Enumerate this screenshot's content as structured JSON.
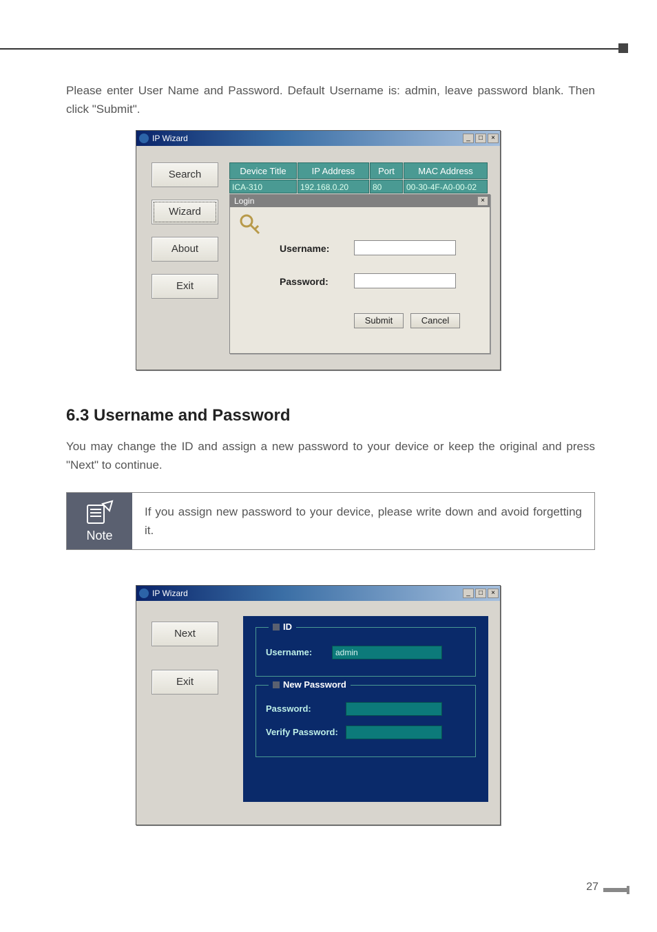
{
  "para1": "Please enter User Name and Password. Default Username is: admin, leave password blank. Then click \"Submit\".",
  "heading": "6.3 Username and Password",
  "para2": "You may change the ID and assign a new password to your device or keep the original and press \"Next\" to continue.",
  "note": {
    "label": "Note",
    "text": "If you assign new password to your device, please write down and avoid forgetting it."
  },
  "win1": {
    "title": "IP Wizard",
    "buttons": {
      "search": "Search",
      "wizard": "Wizard",
      "about": "About",
      "exit": "Exit"
    },
    "headers": {
      "device": "Device Title",
      "ip": "IP Address",
      "port": "Port",
      "mac": "MAC Address"
    },
    "row": {
      "device": "ICA-310",
      "ip": "192.168.0.20",
      "port": "80",
      "mac": "00-30-4F-A0-00-02"
    },
    "login": {
      "title": "Login",
      "username_label": "Username:",
      "password_label": "Password:",
      "submit": "Submit",
      "cancel": "Cancel"
    }
  },
  "win2": {
    "title": "IP Wizard",
    "buttons": {
      "next": "Next",
      "exit": "Exit"
    },
    "id_legend": "ID",
    "username_label": "Username:",
    "username_value": "admin",
    "np_legend": "New Password",
    "password_label": "Password:",
    "verify_label": "Verify Password:"
  },
  "page_number": "27"
}
